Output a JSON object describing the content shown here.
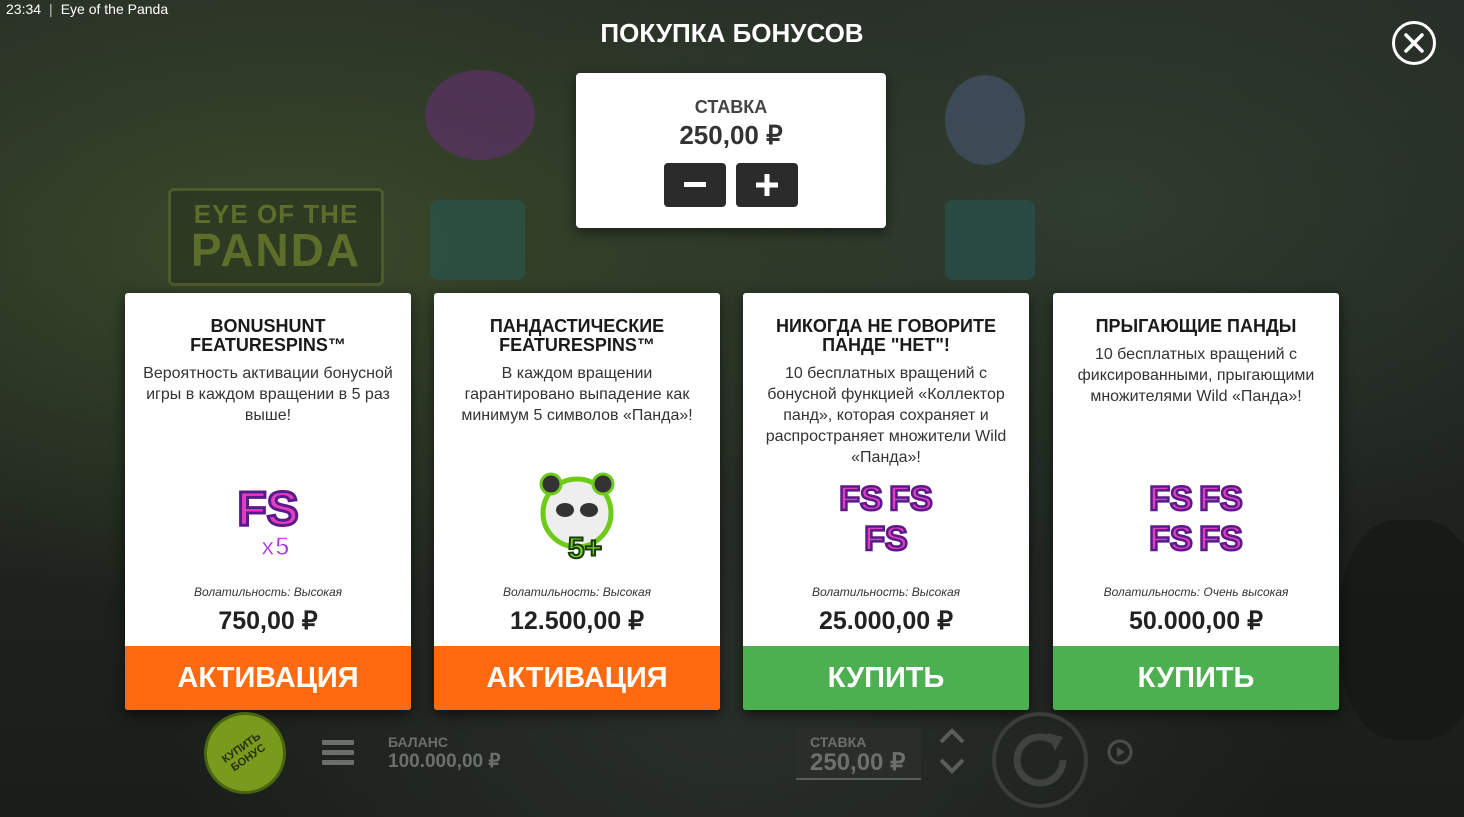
{
  "status": {
    "time": "23:34",
    "app_title": "Eye of the Panda"
  },
  "background_logo": {
    "line1": "EYE OF THE",
    "line2": "PANDA"
  },
  "modal": {
    "title": "ПОКУПКА БОНУСОВ",
    "stake": {
      "label": "СТАВКА",
      "value": "250,00 ₽",
      "minus": "−",
      "plus": "+"
    }
  },
  "cards": [
    {
      "title": "BONUSHUNT\nFEATURESPINS™",
      "description": "Вероятность активации бонусной игры в каждом вращении в 5 раз выше!",
      "image_text": "FS",
      "image_sub": "x5",
      "volatility": "Волатильность: Высокая",
      "price": "750,00 ₽",
      "button": "АКТИВАЦИЯ",
      "button_color": "#ff6a10"
    },
    {
      "title": "ПАНДАСТИЧЕСКИЕ\nFEATURESPINS™",
      "description": "В каждом вращении гарантировано выпадение как минимум 5 символов «Панда»!",
      "image_text": "5+",
      "volatility": "Волатильность: Высокая",
      "price": "12.500,00 ₽",
      "button": "АКТИВАЦИЯ",
      "button_color": "#ff6a10"
    },
    {
      "title": "НИКОГДА НЕ ГОВОРИТЕ\nПАНДЕ \"НЕТ\"!",
      "description": "10 бесплатных вращений с бонусной функцией «Коллектор панд», которая сохраняет и распространяет множители Wild «Панда»!",
      "image_text": "FS",
      "volatility": "Волатильность: Высокая",
      "price": "25.000,00 ₽",
      "button": "КУПИТЬ",
      "button_color": "#4caf50"
    },
    {
      "title": "ПРЫГАЮЩИЕ ПАНДЫ",
      "description": "10 бесплатных вращений с фиксированными, прыгающими множителями Wild «Панда»!",
      "image_text": "FS",
      "volatility": "Волатильность: Очень высокая",
      "price": "50.000,00 ₽",
      "button": "КУПИТЬ",
      "button_color": "#4caf50"
    }
  ],
  "bottom": {
    "buy_bonus": "КУПИТЬ БОНУС",
    "balance_label": "БАЛАНС",
    "balance_value": "100.000,00 ₽",
    "bet_label": "СТАВКА",
    "bet_value": "250,00 ₽"
  }
}
